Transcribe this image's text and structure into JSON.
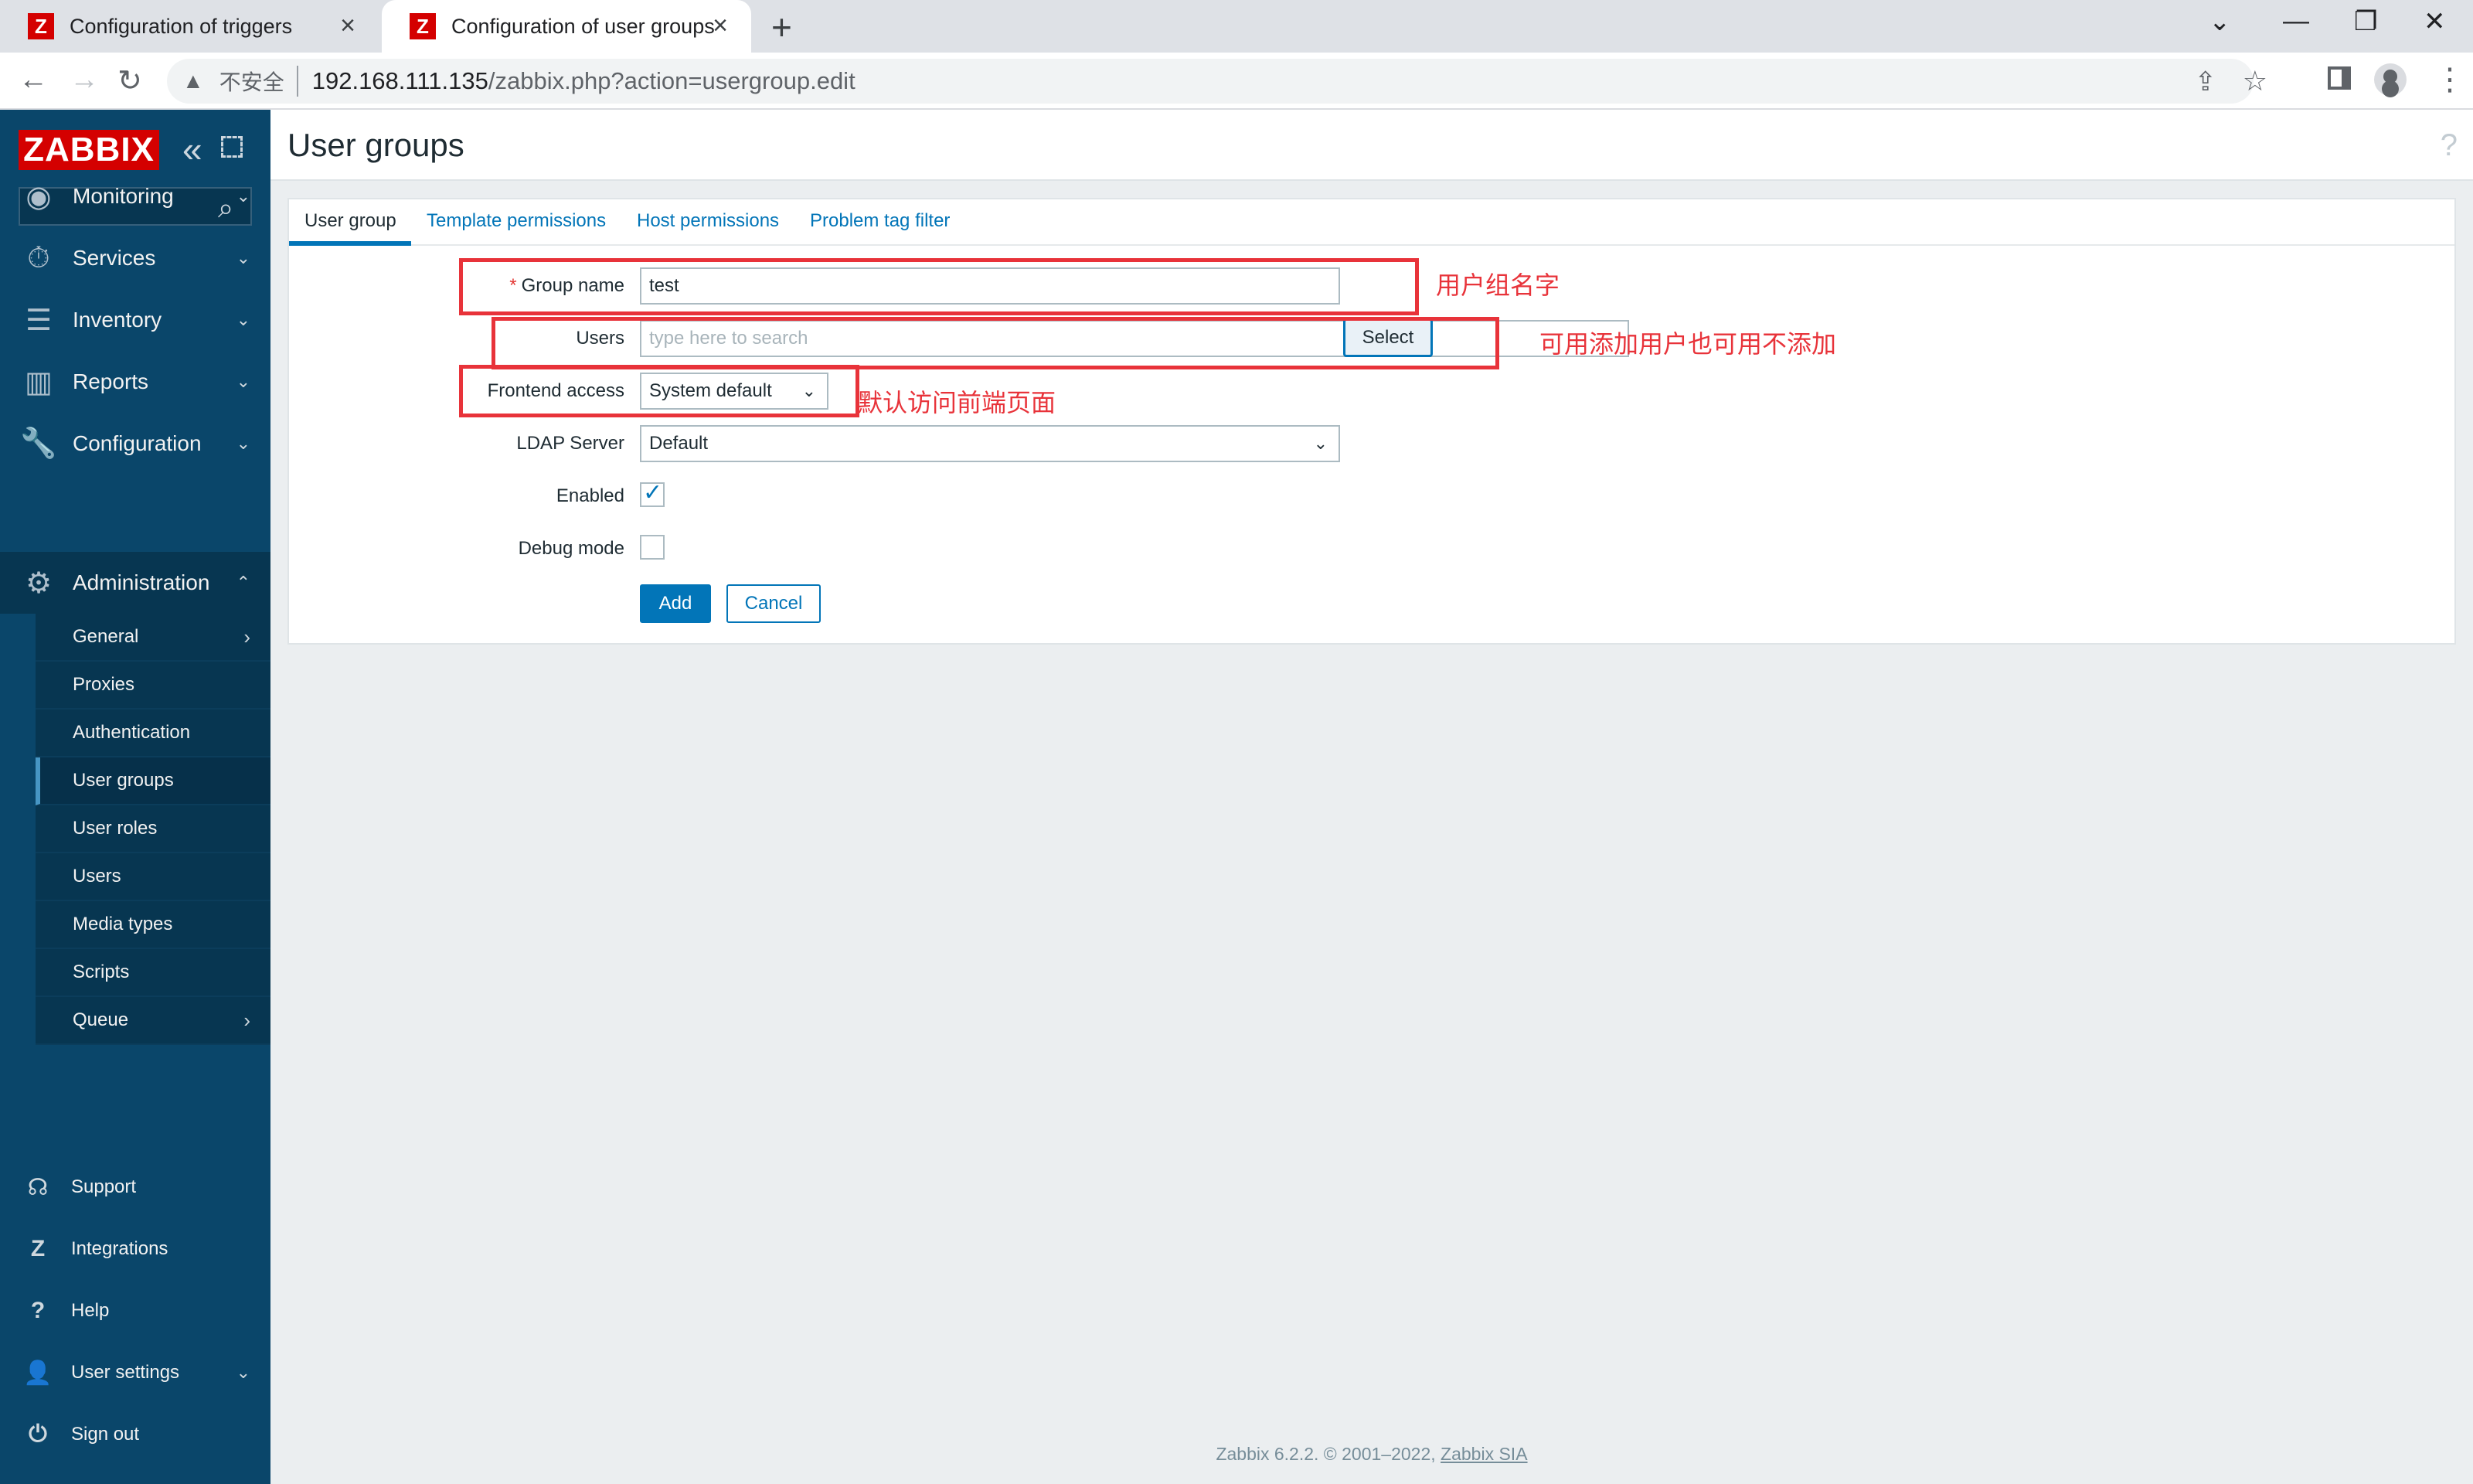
{
  "browser": {
    "tabs": [
      {
        "title": "Configuration of triggers",
        "favicon": "Z"
      },
      {
        "title": "Configuration of user groups",
        "favicon": "Z"
      }
    ],
    "close_glyph": "×",
    "new_tab_glyph": "+",
    "security_label": "不安全",
    "url_host": "192.168.111.135",
    "url_path": "/zabbix.php?action=usergroup.edit"
  },
  "sidebar": {
    "logo": "ZABBIX",
    "menu": [
      {
        "label": "Monitoring",
        "icon": "eye-icon"
      },
      {
        "label": "Services",
        "icon": "stopwatch-icon"
      },
      {
        "label": "Inventory",
        "icon": "list-icon"
      },
      {
        "label": "Reports",
        "icon": "bar-chart-icon"
      },
      {
        "label": "Configuration",
        "icon": "wrench-icon"
      },
      {
        "label": "Administration",
        "icon": "gear-icon"
      }
    ],
    "submenu": [
      "General",
      "Proxies",
      "Authentication",
      "User groups",
      "User roles",
      "Users",
      "Media types",
      "Scripts",
      "Queue"
    ],
    "selected_submenu": "User groups",
    "bottom": [
      {
        "label": "Support",
        "icon": "headset-icon"
      },
      {
        "label": "Integrations",
        "icon": "zabbix-z-icon"
      },
      {
        "label": "Help",
        "icon": "question-icon"
      },
      {
        "label": "User settings",
        "icon": "user-icon"
      },
      {
        "label": "Sign out",
        "icon": "power-icon"
      }
    ]
  },
  "page": {
    "title": "User groups",
    "help": "?"
  },
  "form": {
    "tabs": [
      "User group",
      "Template permissions",
      "Host permissions",
      "Problem tag filter"
    ],
    "group_name_label": "Group name",
    "group_name_required": "*",
    "group_name_value": "test",
    "users_label": "Users",
    "users_placeholder": "type here to search",
    "select_button": "Select",
    "frontend_access_label": "Frontend access",
    "frontend_access_value": "System default",
    "ldap_label": "LDAP Server",
    "ldap_value": "Default",
    "enabled_label": "Enabled",
    "enabled_checked": true,
    "debug_label": "Debug mode",
    "debug_checked": false,
    "add_button": "Add",
    "cancel_button": "Cancel"
  },
  "annotations": {
    "group_name_note": "用户组名字",
    "users_note": "可用添加用户也可用不添加",
    "frontend_note": "默认访问前端页面",
    "color": "#e8333a"
  },
  "footer": {
    "text": "Zabbix 6.2.2. © 2001–2022,",
    "link": "Zabbix SIA"
  }
}
